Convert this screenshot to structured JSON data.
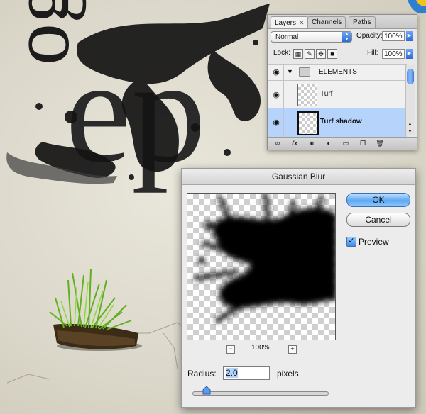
{
  "canvas": {
    "letters": [
      "og",
      "ep"
    ]
  },
  "layers_panel": {
    "tabs": [
      {
        "label": "Layers",
        "close": "✕"
      },
      {
        "label": "Channels"
      },
      {
        "label": "Paths"
      }
    ],
    "blend_mode": "Normal",
    "opacity_label": "Opacity:",
    "opacity_value": "100%",
    "lock_label": "Lock:",
    "fill_label": "Fill:",
    "fill_value": "100%",
    "layers": [
      {
        "name": "ELEMENTS",
        "type": "group"
      },
      {
        "name": "Turf",
        "type": "layer"
      },
      {
        "name": "Turf shadow",
        "type": "layer",
        "selected": true
      }
    ],
    "colors": {
      "selected_row": "#b5d3fb",
      "accent": "#2b6cd6"
    }
  },
  "gaussian_blur": {
    "title": "Gaussian Blur",
    "ok_label": "OK",
    "cancel_label": "Cancel",
    "preview_label": "Preview",
    "preview_checked": true,
    "zoom_value": "100%",
    "zoom_out": "−",
    "zoom_in": "+",
    "radius_label": "Radius:",
    "radius_value": "2.0",
    "radius_units": "pixels"
  }
}
